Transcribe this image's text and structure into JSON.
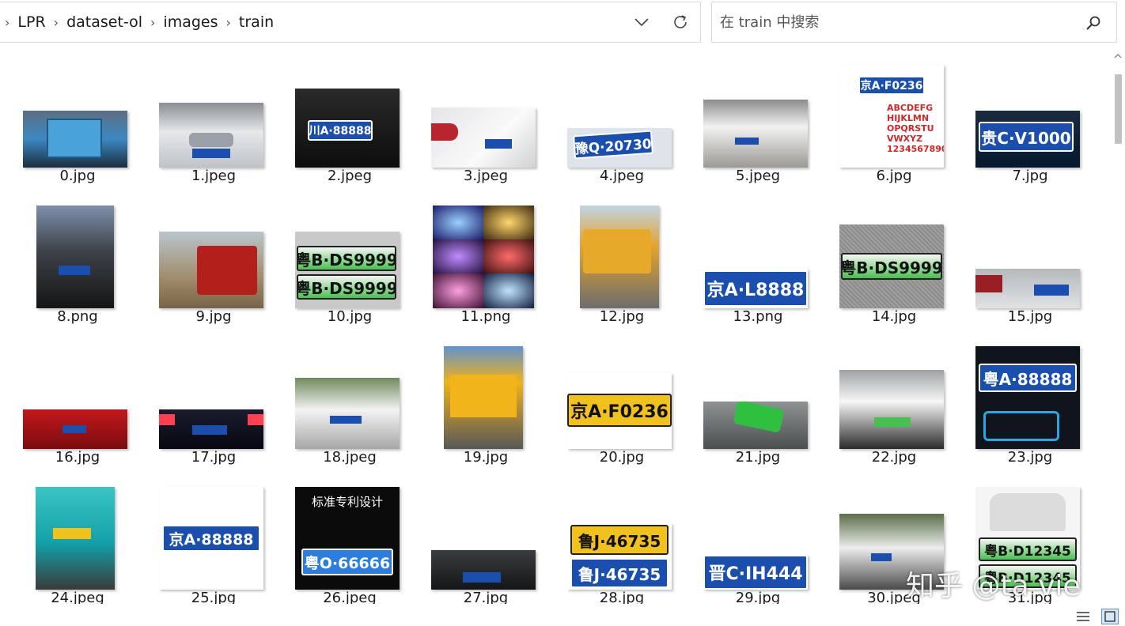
{
  "breadcrumb": [
    "LPR",
    "dataset-ol",
    "images",
    "train"
  ],
  "search": {
    "placeholder": "在 train 中搜索"
  },
  "files": [
    {
      "name": "0.jpg",
      "plate": ""
    },
    {
      "name": "1.jpeg",
      "plate": ""
    },
    {
      "name": "2.jpeg",
      "plate": "川A·88888"
    },
    {
      "name": "3.jpeg",
      "plate": ""
    },
    {
      "name": "4.jpeg",
      "plate": "豫Q·20730"
    },
    {
      "name": "5.jpeg",
      "plate": ""
    },
    {
      "name": "6.jpg",
      "plate": "京A·F0236"
    },
    {
      "name": "7.jpg",
      "plate": "贵C·V1000"
    },
    {
      "name": "8.png",
      "plate": ""
    },
    {
      "name": "9.jpg",
      "plate": ""
    },
    {
      "name": "10.jpg",
      "plate": "粤B·DS9999"
    },
    {
      "name": "11.png",
      "plate": ""
    },
    {
      "name": "12.jpg",
      "plate": ""
    },
    {
      "name": "13.png",
      "plate": "京A·L8888"
    },
    {
      "name": "14.jpg",
      "plate": "粤B·DS9999"
    },
    {
      "name": "15.jpg",
      "plate": ""
    },
    {
      "name": "16.jpg",
      "plate": ""
    },
    {
      "name": "17.jpg",
      "plate": ""
    },
    {
      "name": "18.jpeg",
      "plate": ""
    },
    {
      "name": "19.jpg",
      "plate": ""
    },
    {
      "name": "20.jpg",
      "plate": "京A·F0236"
    },
    {
      "name": "21.jpg",
      "plate": ""
    },
    {
      "name": "22.jpg",
      "plate": ""
    },
    {
      "name": "23.jpg",
      "plate": "粤A·88888"
    },
    {
      "name": "24.jpeg",
      "plate": ""
    },
    {
      "name": "25.jpg",
      "plate": "京A·88888"
    },
    {
      "name": "26.jpeg",
      "plate": "粤O·66666"
    },
    {
      "name": "27.jpg",
      "plate": ""
    },
    {
      "name": "28.jpg",
      "plate": "鲁J·46735"
    },
    {
      "name": "29.jpg",
      "plate": "晋C·IH444"
    },
    {
      "name": "30.jpeg",
      "plate": ""
    },
    {
      "name": "31.jpg",
      "plate": "粤B·D12345"
    }
  ],
  "poster26_title": "标准专利设计",
  "poster6_chars": "ABCDEFG HIJKLMN OPQRSTU VWXYZ 1234567890",
  "watermark": "知乎 @ta vie",
  "colors": {
    "plate_blue": "#1a4fb0",
    "plate_yellow": "#f2c21c",
    "plate_green": "#48c050"
  }
}
